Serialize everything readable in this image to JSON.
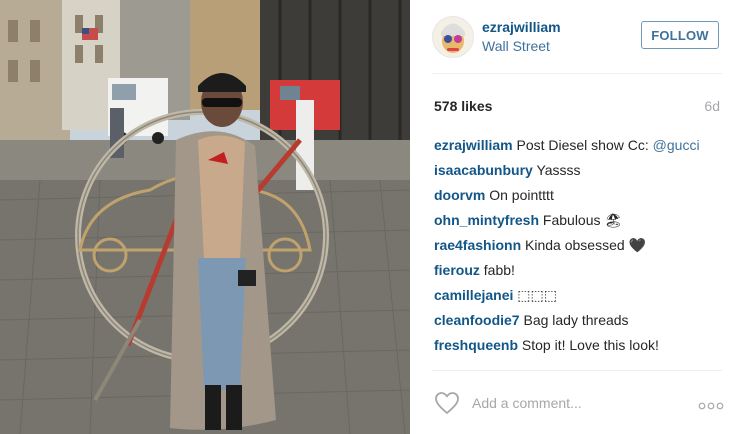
{
  "post": {
    "username": "ezrajwilliam",
    "location": "Wall Street",
    "follow_label": "FOLLOW",
    "likes": "578 likes",
    "time_ago": "6d"
  },
  "comments": [
    {
      "user": "ezrajwilliam",
      "text": "Post Diesel show Cc:",
      "mention": "@gucci"
    },
    {
      "user": "isaacabunbury",
      "text": "Yassss"
    },
    {
      "user": "doorvm",
      "text": "On pointttt"
    },
    {
      "user": "ohn_mintyfresh",
      "text": "Fabulous 🏖"
    },
    {
      "user": "rae4fashionn",
      "text": "Kinda obsessed 🖤"
    },
    {
      "user": "fierouz",
      "text": "fabb!"
    },
    {
      "user": "camillejanei",
      "text": "⬚⬚⬚"
    },
    {
      "user": "cleanfoodie7",
      "text": "Bag lady threads"
    },
    {
      "user": "freshqueenb",
      "text": "Stop it! Love this look!"
    }
  ],
  "footer": {
    "add_comment_placeholder": "Add a comment...",
    "like_icon": "heart-icon",
    "more_icon": "more-options-icon"
  },
  "colors": {
    "username_blue": "#125688",
    "link_blue": "#3f729b",
    "muted_gray": "#a5a7aa"
  }
}
